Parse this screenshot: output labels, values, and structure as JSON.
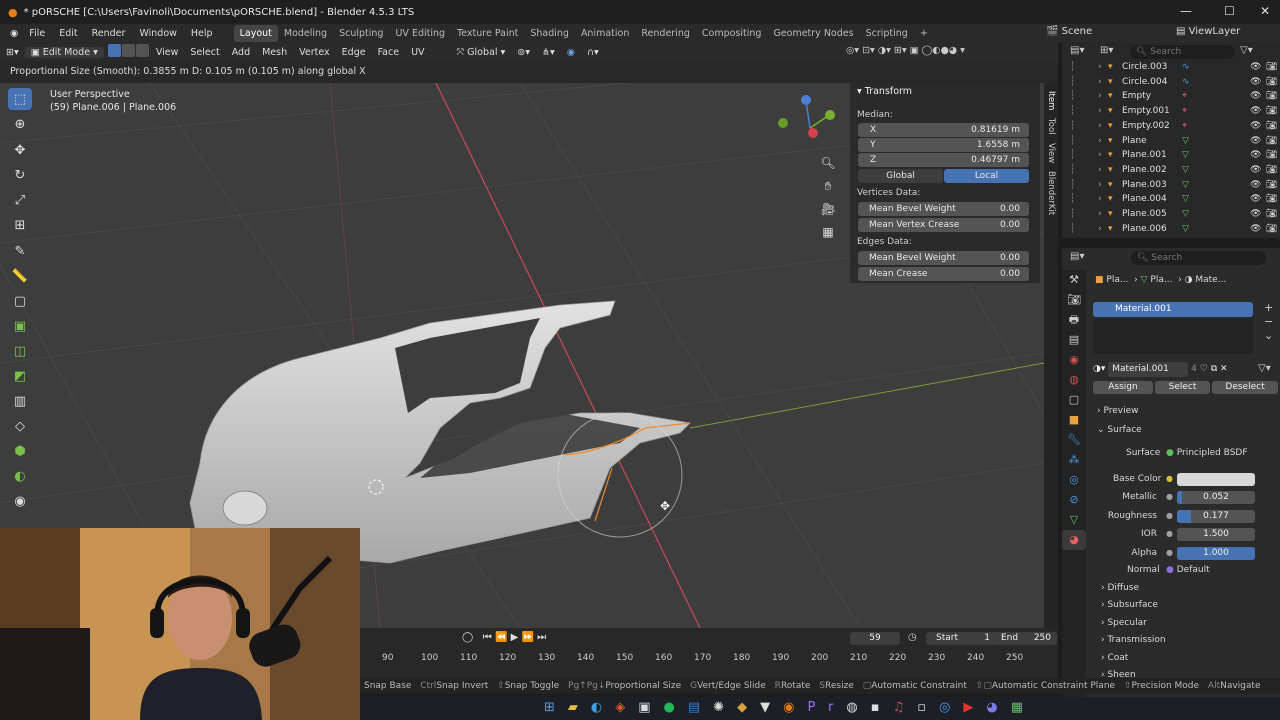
{
  "window": {
    "title": "* pORSCHE [C:\\Users\\Favinoli\\Documents\\pORSCHE.blend] - Blender 4.5.3 LTS"
  },
  "menu": {
    "items": [
      "File",
      "Edit",
      "Render",
      "Window",
      "Help"
    ]
  },
  "workspaces": [
    "Layout",
    "Modeling",
    "Sculpting",
    "UV Editing",
    "Texture Paint",
    "Shading",
    "Animation",
    "Rendering",
    "Compositing",
    "Geometry Nodes",
    "Scripting"
  ],
  "scene": {
    "label": "Scene",
    "view_layer": "ViewLayer"
  },
  "viewport_header": {
    "mode": "Edit Mode",
    "items": [
      "View",
      "Select",
      "Add",
      "Mesh",
      "Vertex",
      "Edge",
      "Face",
      "UV"
    ],
    "orientation": "Global"
  },
  "status_line": "Proportional Size (Smooth): 0.3855 m   D: 0.105 m (0.105 m) along global X",
  "viewport_info": {
    "line1": "User Perspective",
    "line2": "(59) Plane.006 | Plane.006"
  },
  "npanel": {
    "title": "Transform",
    "median_label": "Median:",
    "x": {
      "label": "X",
      "value": "0.81619 m"
    },
    "y": {
      "label": "Y",
      "value": "1.6558 m"
    },
    "z": {
      "label": "Z",
      "value": "0.46797 m"
    },
    "global": "Global",
    "local": "Local",
    "vertices_label": "Vertices Data:",
    "mean_bevel_weight": {
      "label": "Mean Bevel Weight",
      "value": "0.00"
    },
    "mean_vertex_crease": {
      "label": "Mean Vertex Crease",
      "value": "0.00"
    },
    "edges_label": "Edges Data:",
    "edge_bevel_weight": {
      "label": "Mean Bevel Weight",
      "value": "0.00"
    },
    "mean_crease": {
      "label": "Mean Crease",
      "value": "0.00"
    },
    "tabs": [
      "Item",
      "Tool",
      "View",
      "BlenderKit"
    ]
  },
  "outliner": {
    "search_placeholder": "Search",
    "items": [
      "Circle.003",
      "Circle.004",
      "Empty",
      "Empty.001",
      "Empty.002",
      "Plane",
      "Plane.001",
      "Plane.002",
      "Plane.003",
      "Plane.004",
      "Plane.005",
      "Plane.006"
    ]
  },
  "properties": {
    "search_placeholder": "Search",
    "breadcrumb": [
      "Pla...",
      "Pla...",
      "Mate..."
    ],
    "material_slot": "Material.001",
    "material_name": "Material.001",
    "users": "4",
    "assign": "Assign",
    "select": "Select",
    "deselect": "Deselect",
    "preview": "Preview",
    "surface_section": "Surface",
    "surface_label": "Surface",
    "surface_value": "Principled BSDF",
    "base_color_label": "Base Color",
    "metallic": {
      "label": "Metallic",
      "value": "0.052",
      "fill": 0.052
    },
    "roughness": {
      "label": "Roughness",
      "value": "0.177",
      "fill": 0.177
    },
    "ior": {
      "label": "IOR",
      "value": "1.500"
    },
    "alpha": {
      "label": "Alpha",
      "value": "1.000",
      "fill": 1.0
    },
    "normal": {
      "label": "Normal",
      "value": "Default"
    },
    "subsections": [
      "Diffuse",
      "Subsurface",
      "Specular",
      "Transmission",
      "Coat",
      "Sheen"
    ]
  },
  "timeline": {
    "current_frame": "59",
    "start_label": "Start",
    "start": "1",
    "end_label": "End",
    "end": "250",
    "ticks": [
      "90",
      "100",
      "110",
      "120",
      "130",
      "140",
      "150",
      "160",
      "170",
      "180",
      "190",
      "200",
      "210",
      "220",
      "230",
      "240",
      "250"
    ]
  },
  "bottom_status": [
    "Snap Base",
    "Snap Invert",
    "Snap Toggle",
    "Proportional Size",
    "Vert/Edge Slide",
    "Rotate",
    "Resize",
    "Automatic Constraint",
    "Automatic Constraint Plane",
    "Precision Mode",
    "Navigate"
  ],
  "colors": {
    "accent": "#4772b3",
    "viewport": "#3d3d3d",
    "panel": "#2b2b2b",
    "selected_orange": "#f08a2c"
  }
}
